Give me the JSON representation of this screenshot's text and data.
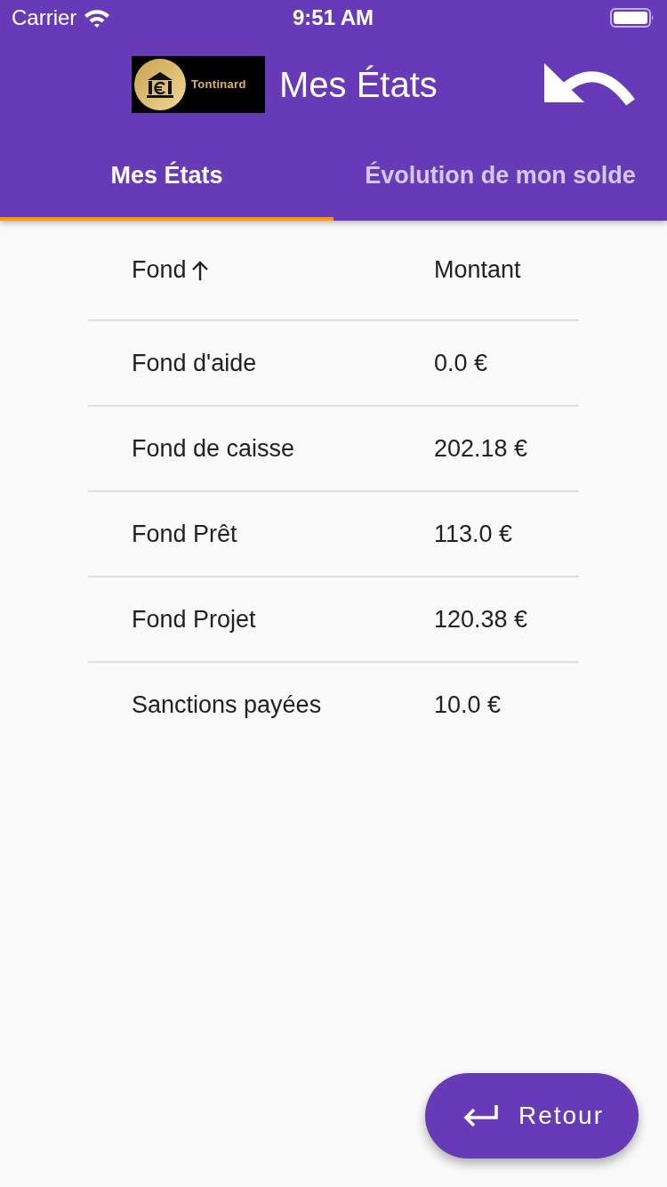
{
  "status_bar": {
    "carrier": "Carrier",
    "time": "9:51 AM"
  },
  "app_bar": {
    "logo_text": "Tontinard",
    "title": "Mes États"
  },
  "tabs": [
    {
      "label": "Mes États",
      "selected": true
    },
    {
      "label": "Évolution de mon solde",
      "selected": false
    }
  ],
  "table": {
    "columns": [
      {
        "label": "Fond",
        "sorted": true
      },
      {
        "label": "Montant",
        "sorted": false
      }
    ],
    "rows": [
      [
        "Fond d'aide",
        "0.0 €"
      ],
      [
        "Fond de caisse",
        "202.18 €"
      ],
      [
        "Fond Prêt",
        "113.0 €"
      ],
      [
        "Fond Projet",
        "120.38 €"
      ],
      [
        "Sanctions payées",
        "10.0 €"
      ]
    ]
  },
  "fab": {
    "label": "Retour"
  }
}
